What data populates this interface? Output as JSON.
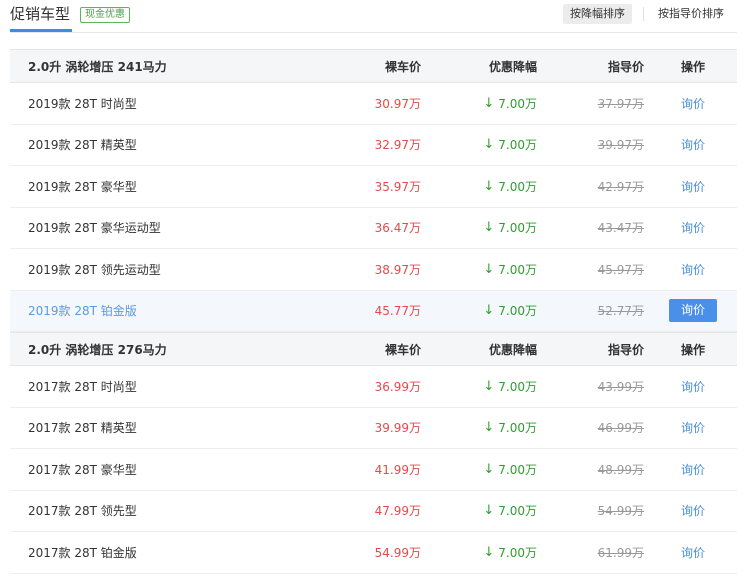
{
  "header": {
    "title": "促销车型",
    "badge": "现金优惠",
    "sort_discount": "按降幅排序",
    "sort_guide": "按指导价排序"
  },
  "icons": {
    "down_arrow": "down-arrow-icon"
  },
  "colors": {
    "price": "#e44a4a",
    "discount": "#2f9e2f",
    "link": "#4a8fdb",
    "accent": "#3c8ce4"
  },
  "groups": [
    {
      "header": {
        "name": "2.0升 涡轮增压 241马力",
        "price": "裸车价",
        "discount": "优惠降幅",
        "guide": "指导价",
        "action": "操作"
      },
      "rows": [
        {
          "name": "2019款 28T 时尚型",
          "price": "30.97万",
          "discount": "7.00万",
          "guide": "37.97万",
          "action": "询价"
        },
        {
          "name": "2019款 28T 精英型",
          "price": "32.97万",
          "discount": "7.00万",
          "guide": "39.97万",
          "action": "询价"
        },
        {
          "name": "2019款 28T 豪华型",
          "price": "35.97万",
          "discount": "7.00万",
          "guide": "42.97万",
          "action": "询价"
        },
        {
          "name": "2019款 28T 豪华运动型",
          "price": "36.47万",
          "discount": "7.00万",
          "guide": "43.47万",
          "action": "询价"
        },
        {
          "name": "2019款 28T 领先运动型",
          "price": "38.97万",
          "discount": "7.00万",
          "guide": "45.97万",
          "action": "询价"
        },
        {
          "name": "2019款 28T 铂金版",
          "price": "45.77万",
          "discount": "7.00万",
          "guide": "52.77万",
          "action": "询价"
        }
      ]
    },
    {
      "header": {
        "name": "2.0升 涡轮增压 276马力",
        "price": "裸车价",
        "discount": "优惠降幅",
        "guide": "指导价",
        "action": "操作"
      },
      "rows": [
        {
          "name": "2017款 28T 时尚型",
          "price": "36.99万",
          "discount": "7.00万",
          "guide": "43.99万",
          "action": "询价"
        },
        {
          "name": "2017款 28T 精英型",
          "price": "39.99万",
          "discount": "7.00万",
          "guide": "46.99万",
          "action": "询价"
        },
        {
          "name": "2017款 28T 豪华型",
          "price": "41.99万",
          "discount": "7.00万",
          "guide": "48.99万",
          "action": "询价"
        },
        {
          "name": "2017款 28T 领先型",
          "price": "47.99万",
          "discount": "7.00万",
          "guide": "54.99万",
          "action": "询价"
        },
        {
          "name": "2017款 28T 铂金版",
          "price": "54.99万",
          "discount": "7.00万",
          "guide": "61.99万",
          "action": "询价"
        }
      ]
    }
  ]
}
